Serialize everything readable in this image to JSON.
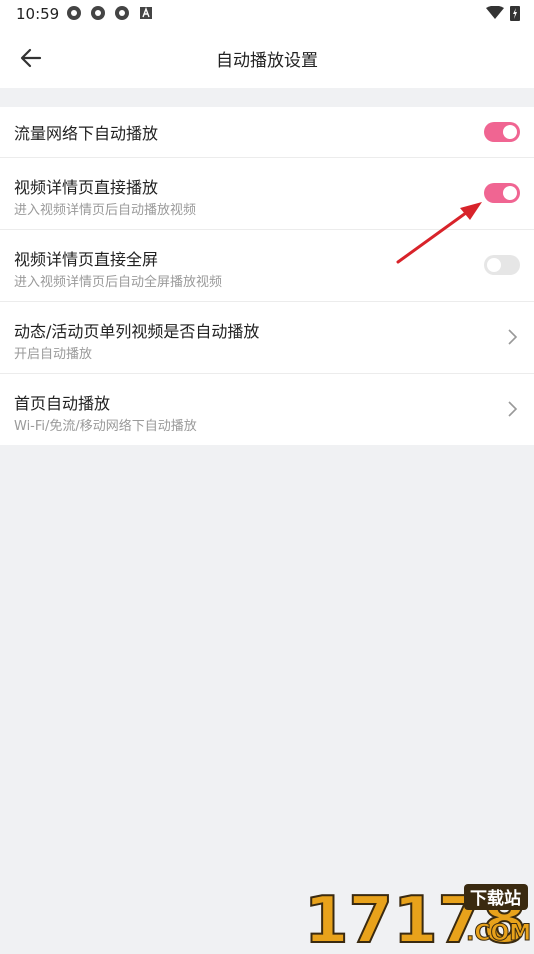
{
  "status_bar": {
    "time": "10:59"
  },
  "header": {
    "title": "自动播放设置"
  },
  "settings": [
    {
      "label": "流量网络下自动播放",
      "control": "toggle",
      "state": "on"
    },
    {
      "label": "视频详情页直接播放",
      "sublabel": "进入视频详情页后自动播放视频",
      "control": "toggle",
      "state": "on"
    },
    {
      "label": "视频详情页直接全屏",
      "sublabel": "进入视频详情页后自动全屏播放视频",
      "control": "toggle",
      "state": "off"
    },
    {
      "label": "动态/活动页单列视频是否自动播放",
      "sublabel": "开启自动播放",
      "control": "chevron"
    },
    {
      "label": "首页自动播放",
      "sublabel": "Wi-Fi/免流/移动网络下自动播放",
      "control": "chevron"
    }
  ],
  "watermark": {
    "number": "17178",
    "badge": "下载站",
    "domain": ".COM"
  },
  "colors": {
    "accent": "#f06592",
    "toggle_off": "#e6e6e6",
    "background": "#f0f1f3",
    "annotation": "#d8232a"
  }
}
